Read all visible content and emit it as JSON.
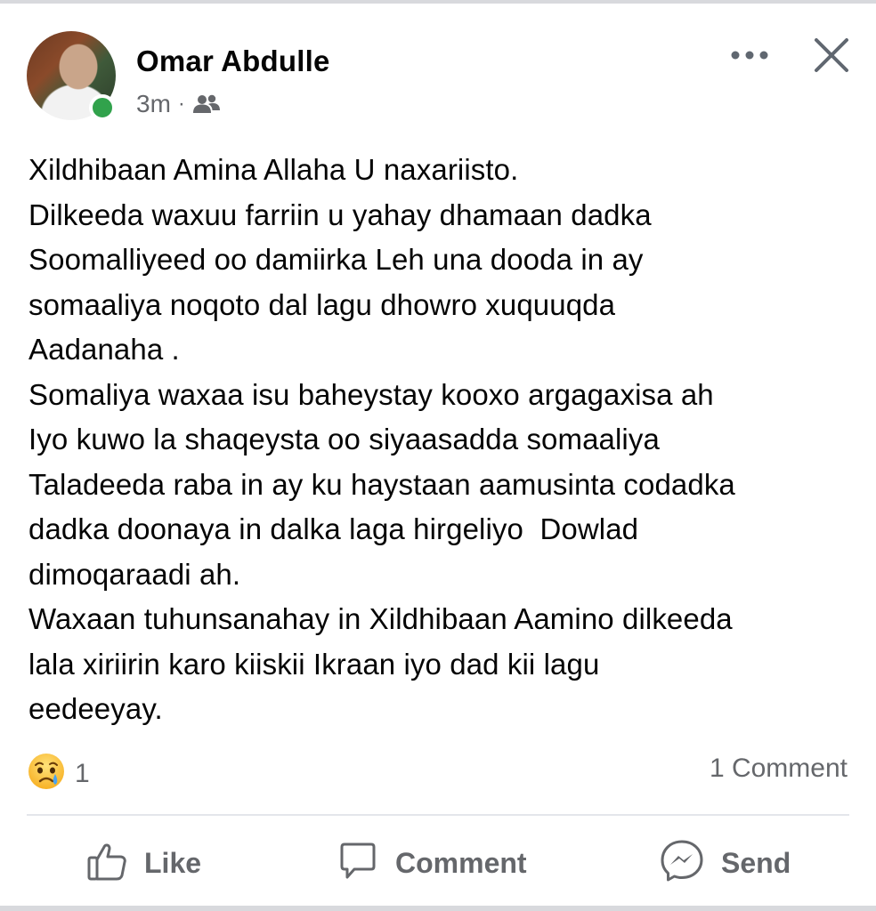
{
  "post": {
    "author": "Omar Abdulle",
    "time": "3m",
    "separator": "·",
    "audience_icon": "friends-icon",
    "lines": [
      "Xildhibaan Amina Allaha U naxariisto.",
      "Dilkeeda waxuu farriin u yahay dhamaan dadka",
      "Soomalliyeed oo damiirka Leh una dooda in ay",
      "somaaliya noqoto dal lagu dhowro xuquuqda",
      "Aadanaha .",
      "Somaliya waxaa isu baheystay kooxo argagaxisa ah",
      "Iyo kuwo la shaqeysta oo siyaasadda somaaliya",
      "Taladeeda raba in ay ku haystaan aamusinta codadka",
      "dadka doonaya in dalka laga hirgeliyo  Dowlad",
      "dimoqaraadi ah.",
      "Waxaan tuhunsanahay in Xildhibaan Aamino dilkeeda",
      "lala xiriirin karo kiiskii Ikraan iyo dad kii lagu",
      "eedeeyay."
    ]
  },
  "reactions": {
    "icon": "crying-face-icon",
    "count": "1"
  },
  "comments": {
    "label": "1 Comment"
  },
  "actions": {
    "like": "Like",
    "comment": "Comment",
    "send": "Send"
  },
  "colors": {
    "online": "#31a24c",
    "secondary_text": "#65676b",
    "primary_text": "#050505",
    "divider": "#e4e6eb"
  }
}
